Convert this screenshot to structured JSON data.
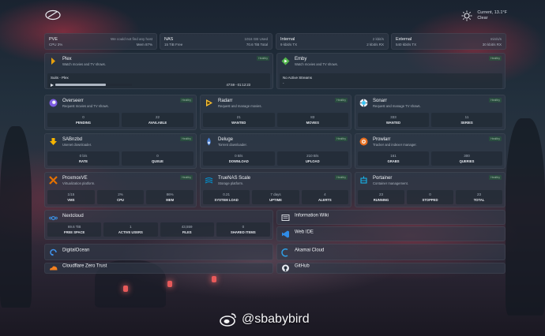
{
  "weather": {
    "line1": "Clear",
    "line2": "Current, 13.1°F"
  },
  "stats": [
    {
      "k": "PVE",
      "k2": "CPU  3%",
      "r1": "We could not find any host",
      "r2": "Mem   87%"
    },
    {
      "k": "NAS",
      "k2": "15 TiB Free",
      "r1": "1016 GB Used",
      "r2": "70.6 TiB Total"
    },
    {
      "k": "Internal",
      "k2": "9 kbit/s TX",
      "r1": "2 kbit/s",
      "r2": "2 kbit/s RX"
    },
    {
      "k": "External",
      "k2": "540 kbit/s TX",
      "r1": "min/s/s",
      "r2": "30 kbit/s RX"
    }
  ],
  "plex": {
    "name": "Plex",
    "desc": "Watch movies and TV shows.",
    "tag": "Healthy",
    "stream_title": "Suits - Plex",
    "stream_time": "47:59 - 01:12:23",
    "progress": 0.66
  },
  "emby": {
    "name": "Emby",
    "desc": "Watch movies and TV shows.",
    "tag": "Healthy",
    "stream_title": "No Active Streams",
    "stream_dash": "-"
  },
  "services": [
    {
      "name": "Overseerr",
      "desc": "Request movies and TV shows.",
      "tag": "Healthy",
      "m": [
        {
          "v": "0",
          "l": "PENDING"
        },
        {
          "v": "22",
          "l": "AVAILABLE"
        }
      ]
    },
    {
      "name": "Radarr",
      "desc": "Request and manage movies.",
      "tag": "Healthy",
      "m": [
        {
          "v": "21",
          "l": "WANTED"
        },
        {
          "v": "83",
          "l": "MOVIES"
        }
      ]
    },
    {
      "name": "Sonarr",
      "desc": "Request and manage TV shows.",
      "tag": "Healthy",
      "m": [
        {
          "v": "333",
          "l": "WANTED"
        },
        {
          "v": "11",
          "l": "SERIES"
        }
      ]
    },
    {
      "name": "SABnzbd",
      "desc": "Usenet downloader.",
      "tag": "Healthy",
      "m": [
        {
          "v": "0 b/s",
          "l": "RATE"
        },
        {
          "v": "0",
          "l": "QUEUE"
        }
      ]
    },
    {
      "name": "Deluge",
      "desc": "Torrent downloader.",
      "tag": "Healthy",
      "m": [
        {
          "v": "0 B/s",
          "l": "DOWNLOAD"
        },
        {
          "v": "210 B/s",
          "l": "UPLOAD"
        }
      ]
    },
    {
      "name": "Prowlarr",
      "desc": "Tracker and indexer manager.",
      "tag": "Healthy",
      "m": [
        {
          "v": "161",
          "l": "GRABS"
        },
        {
          "v": "300",
          "l": "QUERIES"
        }
      ]
    },
    {
      "name": "ProxmoxVE",
      "desc": "Virtualization platform.",
      "tag": "Healthy",
      "m": [
        {
          "v": "1/15",
          "l": "VMS"
        },
        {
          "v": "2%",
          "l": "CPU"
        },
        {
          "v": "86%",
          "l": "MEM"
        }
      ]
    },
    {
      "name": "TrueNAS Scale",
      "desc": "Storage platform.",
      "tag": "Healthy",
      "m": [
        {
          "v": "0.21",
          "l": "SYSTEM LOAD"
        },
        {
          "v": "7 days",
          "l": "UPTIME"
        },
        {
          "v": "4",
          "l": "ALERTS"
        }
      ]
    },
    {
      "name": "Portainer",
      "desc": "Container management.",
      "tag": "Healthy",
      "m": [
        {
          "v": "23",
          "l": "RUNNING"
        },
        {
          "v": "0",
          "l": "STOPPED"
        },
        {
          "v": "23",
          "l": "TOTAL"
        }
      ]
    }
  ],
  "nextcloud": {
    "name": "Nextcloud",
    "m": [
      {
        "v": "69.6 TiB",
        "l": "FREE SPACE"
      },
      {
        "v": "1",
        "l": "ACTIVE USERS"
      },
      {
        "v": "43,559",
        "l": "FILES"
      },
      {
        "v": "0",
        "l": "SHARED ITEMS"
      }
    ]
  },
  "links_left": [
    {
      "name": "DigitalOcean"
    },
    {
      "name": "Cloudflare Zero Trust"
    }
  ],
  "links_right": [
    {
      "name": "Information Wiki"
    },
    {
      "name": "Web IDE"
    },
    {
      "name": "Akamai Cloud"
    },
    {
      "name": "GitHub"
    }
  ],
  "watermark": "@sbabybird"
}
